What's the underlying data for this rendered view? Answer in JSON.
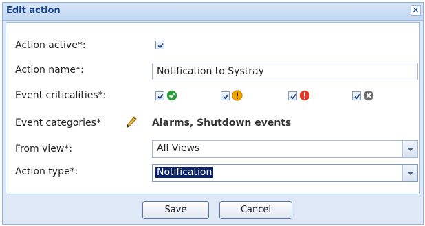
{
  "dialog": {
    "title": "Edit action",
    "close_glyph": "✕"
  },
  "form": {
    "action_active": {
      "label": "Action active*:",
      "checked": true
    },
    "action_name": {
      "label": "Action name*:",
      "value": "Notification to Systray"
    },
    "event_criticalities": {
      "label": "Event criticalities*:",
      "items": [
        {
          "icon": "check-circle-icon",
          "color": "#2e9e3e",
          "checked": true
        },
        {
          "icon": "warning-circle-icon",
          "color": "#f0a500",
          "checked": true
        },
        {
          "icon": "error-circle-icon",
          "color": "#e03a2a",
          "checked": true
        },
        {
          "icon": "x-circle-icon",
          "color": "#6d6d6d",
          "checked": true
        }
      ]
    },
    "event_categories": {
      "label": "Event categories*",
      "value": "Alarms, Shutdown events",
      "icon": "pencil-icon"
    },
    "from_view": {
      "label": "From view*:",
      "value": "All Views"
    },
    "action_type": {
      "label": "Action type*:",
      "value": "Notification"
    }
  },
  "buttons": {
    "save": "Save",
    "cancel": "Cancel"
  }
}
